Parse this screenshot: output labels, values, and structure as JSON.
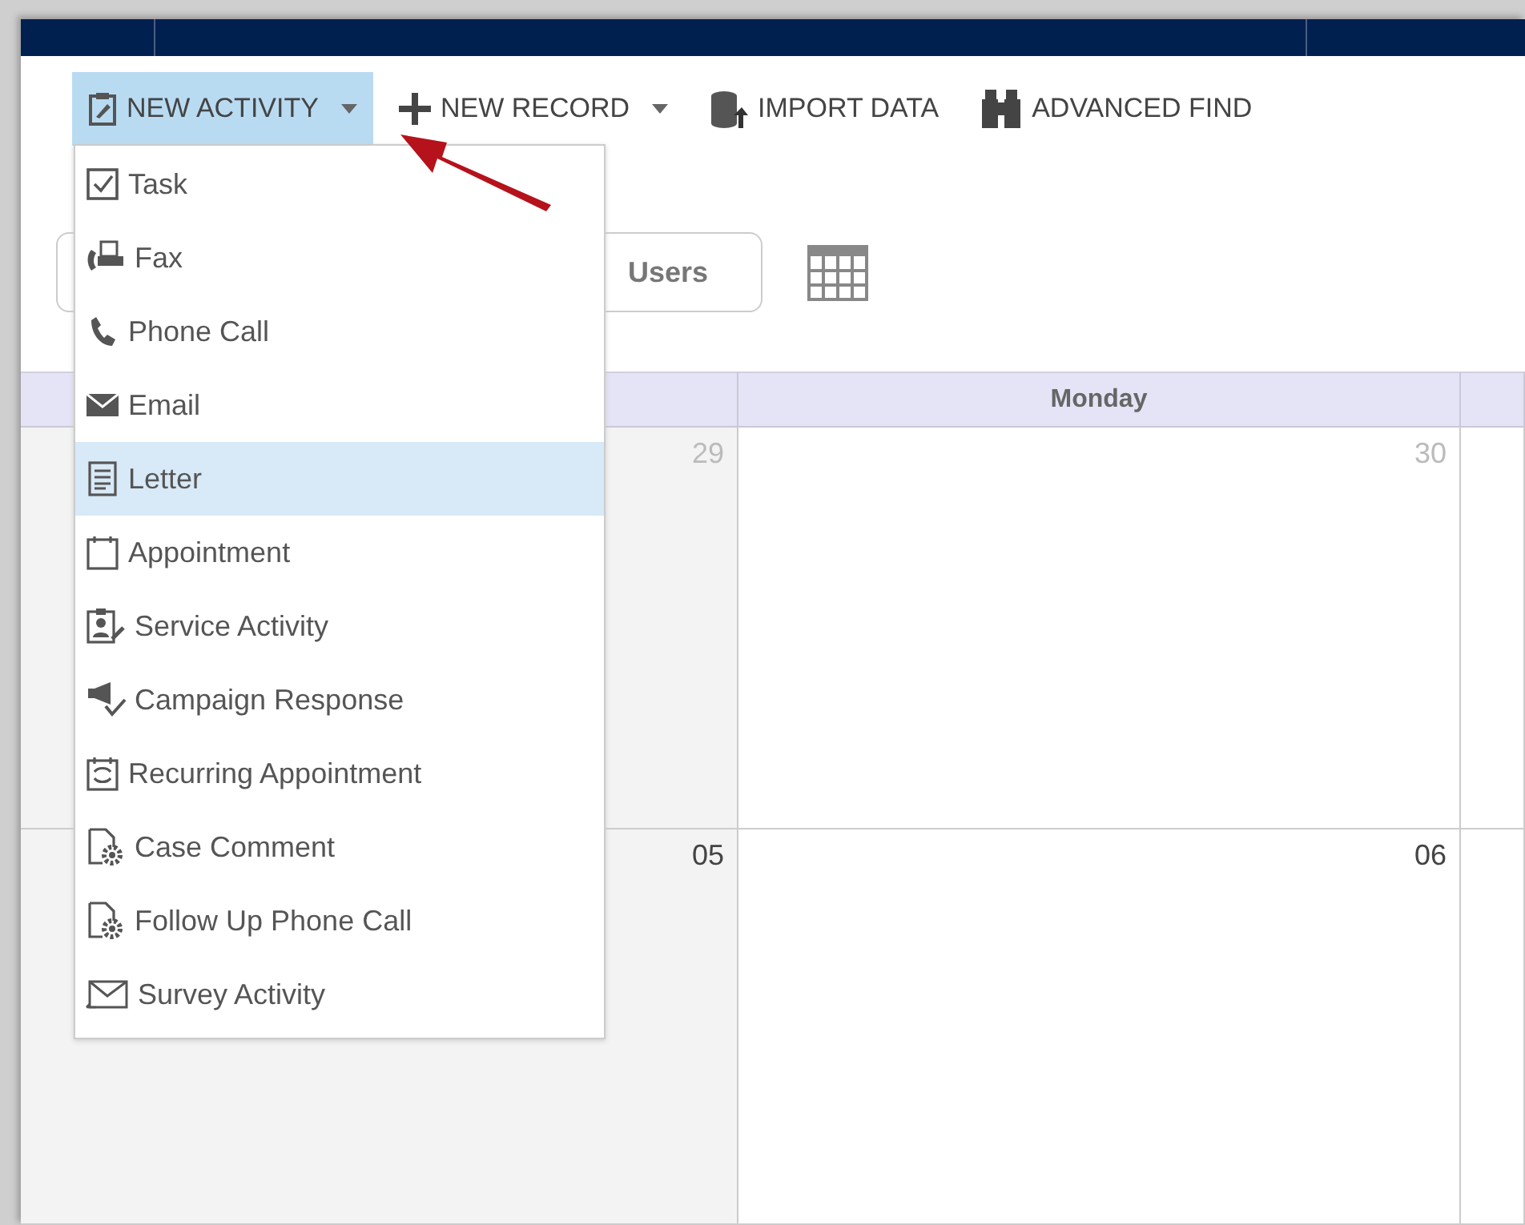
{
  "toolbar": [
    {
      "label": "NEW ACTIVITY",
      "kind": "activity",
      "dropdown": true,
      "open": true
    },
    {
      "label": "NEW RECORD",
      "kind": "plus",
      "dropdown": true,
      "open": false
    },
    {
      "label": "IMPORT DATA",
      "kind": "import",
      "dropdown": false,
      "open": false
    },
    {
      "label": "ADVANCED FIND",
      "kind": "find",
      "dropdown": false,
      "open": false
    }
  ],
  "menu": [
    {
      "label": "Task",
      "kind": "task",
      "selected": false
    },
    {
      "label": "Fax",
      "kind": "fax",
      "selected": false
    },
    {
      "label": "Phone Call",
      "kind": "phone",
      "selected": false
    },
    {
      "label": "Email",
      "kind": "email",
      "selected": false
    },
    {
      "label": "Letter",
      "kind": "letter",
      "selected": true
    },
    {
      "label": "Appointment",
      "kind": "appointment",
      "selected": false
    },
    {
      "label": "Service Activity",
      "kind": "service",
      "selected": false
    },
    {
      "label": "Campaign Response",
      "kind": "campaign",
      "selected": false
    },
    {
      "label": "Recurring Appointment",
      "kind": "recurring",
      "selected": false
    },
    {
      "label": "Case Comment",
      "kind": "case",
      "selected": false
    },
    {
      "label": "Follow Up Phone Call",
      "kind": "case",
      "selected": false
    },
    {
      "label": "Survey Activity",
      "kind": "survey",
      "selected": false
    }
  ],
  "view_switch": {
    "label": "Users",
    "selected": false
  },
  "calendar": {
    "columns": [
      {
        "label": "Monday"
      }
    ],
    "weeks": [
      {
        "days": [
          {
            "day": "29",
            "other_month": true,
            "shaded": true
          },
          {
            "day": "30",
            "other_month": true,
            "shaded": false
          }
        ]
      },
      {
        "days": [
          {
            "day": "05",
            "other_month": false,
            "shaded": true
          },
          {
            "day": "06",
            "other_month": false,
            "shaded": false
          }
        ]
      }
    ]
  }
}
